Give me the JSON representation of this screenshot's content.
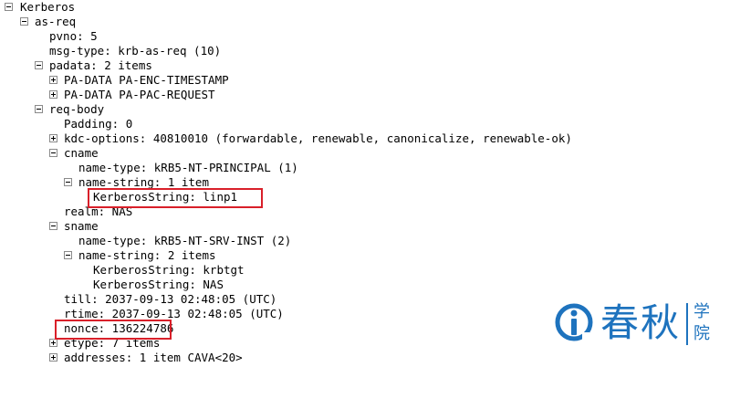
{
  "tree": {
    "rows": [
      {
        "text": "Kerberos",
        "toggle": "collapse"
      },
      {
        "text": "as-req",
        "toggle": "collapse"
      },
      {
        "text": "pvno: 5",
        "toggle": "none"
      },
      {
        "text": "msg-type: krb-as-req (10)",
        "toggle": "none"
      },
      {
        "text": "padata: 2 items",
        "toggle": "collapse"
      },
      {
        "text": "PA-DATA PA-ENC-TIMESTAMP",
        "toggle": "expand"
      },
      {
        "text": "PA-DATA PA-PAC-REQUEST",
        "toggle": "expand"
      },
      {
        "text": "req-body",
        "toggle": "collapse"
      },
      {
        "text": "Padding: 0",
        "toggle": "none"
      },
      {
        "text": "kdc-options: 40810010 (forwardable, renewable, canonicalize, renewable-ok)",
        "toggle": "expand"
      },
      {
        "text": "cname",
        "toggle": "collapse"
      },
      {
        "text": "name-type: kRB5-NT-PRINCIPAL (1)",
        "toggle": "none"
      },
      {
        "text": "name-string: 1 item",
        "toggle": "collapse"
      },
      {
        "text": "KerberosString: linp1",
        "toggle": "none"
      },
      {
        "text": "realm: NAS",
        "toggle": "none"
      },
      {
        "text": "sname",
        "toggle": "collapse"
      },
      {
        "text": "name-type: kRB5-NT-SRV-INST (2)",
        "toggle": "none"
      },
      {
        "text": "name-string: 2 items",
        "toggle": "collapse"
      },
      {
        "text": "KerberosString: krbtgt",
        "toggle": "none"
      },
      {
        "text": "KerberosString: NAS",
        "toggle": "none"
      },
      {
        "text": "till: 2037-09-13 02:48:05 (UTC)",
        "toggle": "none"
      },
      {
        "text": "rtime: 2037-09-13 02:48:05 (UTC)",
        "toggle": "none"
      },
      {
        "text": "nonce: 136224786",
        "toggle": "none"
      },
      {
        "text": "etype: 7 items",
        "toggle": "expand"
      },
      {
        "text": "addresses: 1 item CAVA<20>",
        "toggle": "expand"
      }
    ]
  },
  "logo": {
    "main": "春秋",
    "side": "学院"
  },
  "colors": {
    "highlight": "#d9202a",
    "logo": "#1e73be"
  }
}
